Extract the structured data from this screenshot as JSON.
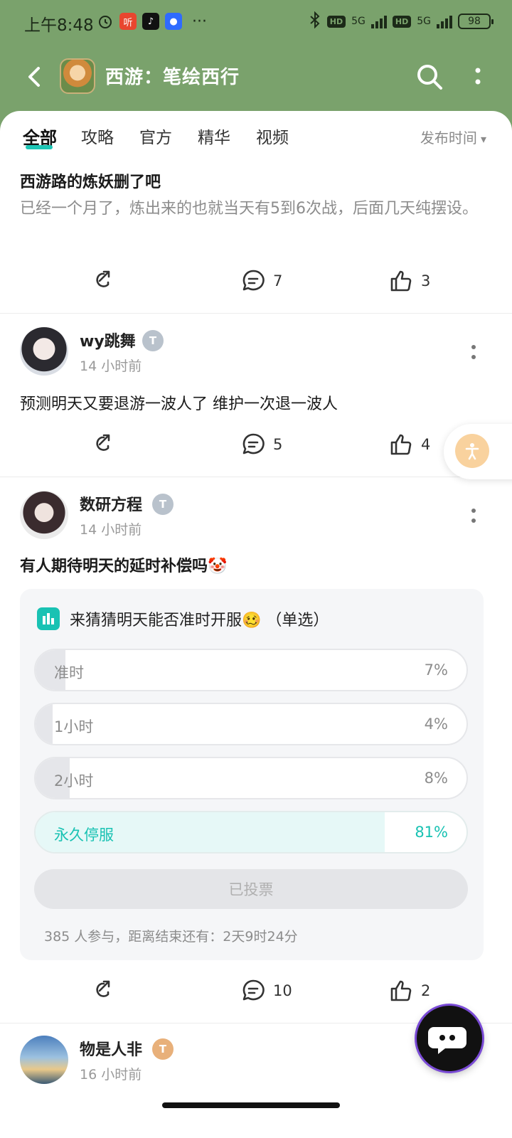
{
  "status_bar": {
    "time": "上午8:48",
    "signal": "5G",
    "battery": "98"
  },
  "header": {
    "title": "西游：笔绘西行"
  },
  "tabs": {
    "items": [
      "全部",
      "攻略",
      "官方",
      "精华",
      "视频"
    ],
    "sort_label": "发布时间"
  },
  "posts": [
    {
      "title": "西游路的炼妖删了吧",
      "body": "已经一个月了，炼出来的也就当天有5到6次战，后面几天纯摆设。",
      "comments": "7",
      "likes": "3"
    },
    {
      "author": "wy跳舞",
      "time": "14 小时前",
      "text": "预测明天又要退游一波人了 维护一次退一波人",
      "comments": "5",
      "likes": "4"
    },
    {
      "author": "数研方程",
      "time": "14 小时前",
      "text": "有人期待明天的延时补偿吗🤡",
      "poll": {
        "title": "来猜猜明天能否准时开服🥴 （单选）",
        "options": [
          {
            "label": "准时",
            "percent": "7%",
            "fill": 0.07,
            "selected": false
          },
          {
            "label": "1小时",
            "percent": "4%",
            "fill": 0.04,
            "selected": false
          },
          {
            "label": "2小时",
            "percent": "8%",
            "fill": 0.08,
            "selected": false
          },
          {
            "label": "永久停服",
            "percent": "81%",
            "fill": 0.81,
            "selected": true
          }
        ],
        "voted_label": "已投票",
        "footer": "385 人参与，距离结束还有：2天9时24分"
      },
      "comments": "10",
      "likes": "2"
    },
    {
      "author": "物是人非",
      "time": "16 小时前"
    }
  ],
  "colors": {
    "header_bg": "#7aa26c",
    "accent": "#19c2b3"
  }
}
